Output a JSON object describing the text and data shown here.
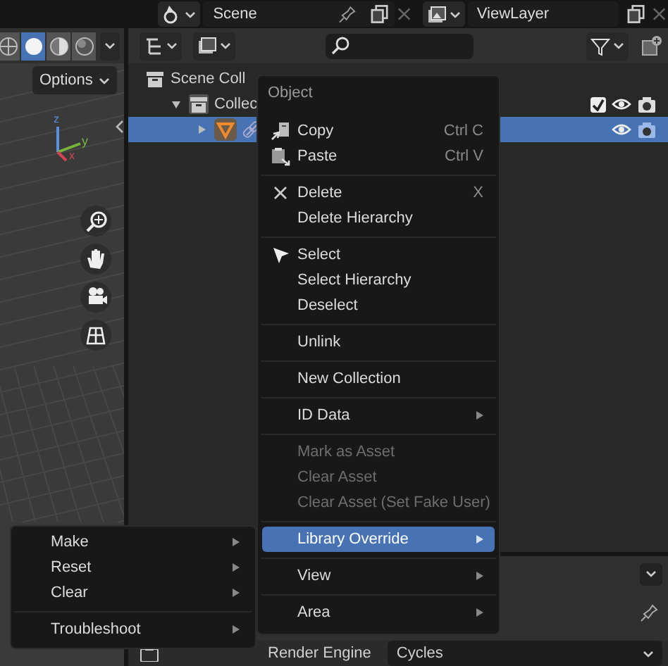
{
  "top_bar": {
    "scene": "Scene",
    "view_layer": "ViewLayer"
  },
  "viewport": {
    "shading_modes": [
      {
        "selected": false
      },
      {
        "selected": true
      },
      {
        "selected": false
      },
      {
        "selected": false
      }
    ],
    "options_button": "Options",
    "axes": [
      "z",
      "y",
      "x"
    ]
  },
  "outliner": {
    "rows": [
      {
        "label": "Scene Coll",
        "selected": false,
        "children": [
          {
            "label": "Collec",
            "selected": false,
            "expanded": true,
            "checked": true,
            "children": [
              {
                "selected": true,
                "expanded": false
              }
            ]
          }
        ]
      }
    ]
  },
  "context_menu": {
    "title": "Object",
    "sections": [
      [
        {
          "label": "Copy",
          "shortcut": "Ctrl C",
          "selected": false,
          "disabled": false,
          "submenu": false
        },
        {
          "label": "Paste",
          "shortcut": "Ctrl V",
          "selected": false,
          "disabled": false,
          "submenu": false
        }
      ],
      [
        {
          "label": "Delete",
          "shortcut": "X",
          "selected": false,
          "disabled": false,
          "submenu": false
        },
        {
          "label": "Delete Hierarchy",
          "selected": false,
          "disabled": false,
          "submenu": false
        }
      ],
      [
        {
          "label": "Select",
          "selected": false,
          "disabled": false,
          "submenu": false
        },
        {
          "label": "Select Hierarchy",
          "selected": false,
          "disabled": false,
          "submenu": false
        },
        {
          "label": "Deselect",
          "selected": false,
          "disabled": false,
          "submenu": false
        }
      ],
      [
        {
          "label": "Unlink",
          "selected": false,
          "disabled": false,
          "submenu": false
        }
      ],
      [
        {
          "label": "New Collection",
          "selected": false,
          "disabled": false,
          "submenu": false
        }
      ],
      [
        {
          "label": "ID Data",
          "selected": false,
          "disabled": false,
          "submenu": true
        }
      ],
      [
        {
          "label": "Mark as Asset",
          "selected": false,
          "disabled": true,
          "submenu": false
        },
        {
          "label": "Clear Asset",
          "selected": false,
          "disabled": true,
          "submenu": false
        },
        {
          "label": "Clear Asset (Set Fake User)",
          "selected": false,
          "disabled": true,
          "submenu": false
        }
      ],
      [
        {
          "label": "Library Override",
          "selected": true,
          "disabled": false,
          "submenu": true
        }
      ],
      [
        {
          "label": "View",
          "selected": false,
          "disabled": false,
          "submenu": true
        }
      ],
      [
        {
          "label": "Area",
          "selected": false,
          "disabled": false,
          "submenu": true
        }
      ]
    ]
  },
  "submenu": {
    "sections": [
      [
        {
          "label": "Make",
          "selected": false,
          "disabled": false,
          "submenu": true
        },
        {
          "label": "Reset",
          "selected": false,
          "disabled": false,
          "submenu": true
        },
        {
          "label": "Clear",
          "selected": false,
          "disabled": false,
          "submenu": true
        }
      ],
      [
        {
          "label": "Troubleshoot",
          "selected": false,
          "disabled": false,
          "submenu": true
        }
      ]
    ]
  },
  "properties": {
    "render_engine_label": "Render Engine",
    "render_engine": "Cycles"
  }
}
